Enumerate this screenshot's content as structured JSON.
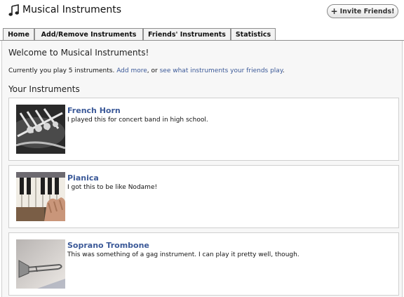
{
  "app": {
    "title": "Musical Instruments",
    "icon": "music-note-icon",
    "invite_label": "Invite Friends!"
  },
  "tabs": [
    {
      "label": "Home"
    },
    {
      "label": "Add/Remove Instruments"
    },
    {
      "label": "Friends' Instruments"
    },
    {
      "label": "Statistics"
    }
  ],
  "main": {
    "welcome": "Welcome to Musical Instruments!",
    "status_prefix": "Currently you play 5 instruments.",
    "add_more": "Add more",
    "or_text": ", or",
    "friends_link": "see what instruments your friends play",
    "period": ".",
    "section_title": "Your Instruments"
  },
  "instruments": [
    {
      "name": "French Horn",
      "note": "I played this for concert band in high school."
    },
    {
      "name": "Pianica",
      "note": "I got this to be like Nodame!"
    },
    {
      "name": "Soprano Trombone",
      "note": "This was something of a gag instrument. I can play it pretty well, though."
    }
  ],
  "colors": {
    "link": "#3b5998",
    "panel_bg": "#f7f7f7",
    "card_border": "#cfcfcf"
  }
}
